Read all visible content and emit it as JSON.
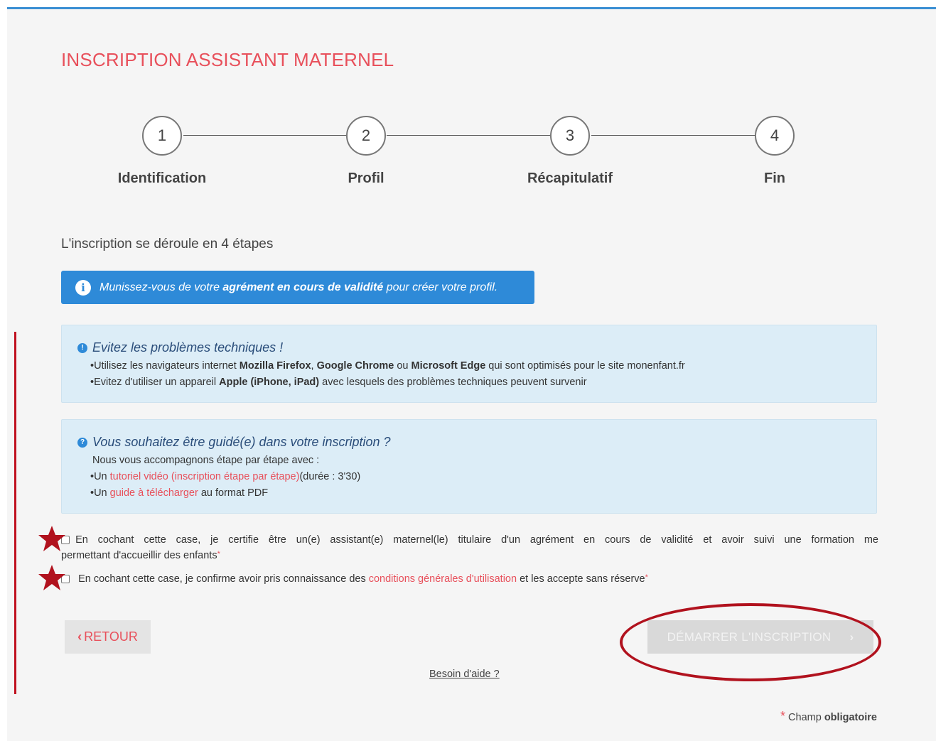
{
  "page": {
    "title": "INSCRIPTION ASSISTANT MATERNEL"
  },
  "stepper": {
    "steps": [
      {
        "number": "1",
        "label": "Identification"
      },
      {
        "number": "2",
        "label": "Profil"
      },
      {
        "number": "3",
        "label": "Récapitulatif"
      },
      {
        "number": "4",
        "label": "Fin"
      }
    ]
  },
  "subtitle": "L'inscription se déroule en 4 étapes",
  "info_bar": {
    "icon": "info-icon",
    "text_before": "Munissez-vous de votre ",
    "text_bold": "agrément en cours de validité",
    "text_after": " pour créer votre profil."
  },
  "panel_technical": {
    "title": "Evitez les problèmes techniques !",
    "line1": {
      "prefix": "•Utilisez les navigateurs internet ",
      "b1": "Mozilla Firefox",
      "sep1": ", ",
      "b2": "Google Chrome",
      "sep2": " ou ",
      "b3": "Microsoft Edge",
      "suffix": " qui sont optimisés pour le site monenfant.fr"
    },
    "line2": {
      "prefix": "•Evitez d'utiliser un appareil ",
      "b1": "Apple (iPhone, iPad)",
      "suffix": " avec lesquels des problèmes techniques peuvent survenir"
    }
  },
  "panel_guide": {
    "title": "Vous souhaitez être guidé(e) dans votre inscription ?",
    "intro": "Nous vous accompagnons étape par étape avec :",
    "line1": {
      "prefix": "•Un ",
      "link": "tutoriel vidéo (inscription étape par étape)",
      "suffix": "(durée : 3'30)"
    },
    "line2": {
      "prefix": "•Un ",
      "link": "guide à télécharger",
      "suffix": " au format PDF"
    }
  },
  "checkboxes": {
    "certify": {
      "line1": "En cochant cette case, je certifie être un(e) assistant(e) maternel(le) titulaire d'un agrément en cours de validité et avoir suivi une formation me",
      "line2": "permettant d'accueillir des enfants",
      "required": "*",
      "checked": false
    },
    "cgu": {
      "prefix": "En cochant cette case, je confirme avoir pris connaissance des ",
      "link": "conditions générales d'utilisation",
      "suffix": " et les accepte sans réserve",
      "required": "*",
      "checked": false
    }
  },
  "buttons": {
    "back": "RETOUR",
    "start": "DÉMARRER L'INSCRIPTION"
  },
  "help_link": "Besoin d'aide ?",
  "required_note": {
    "asterisk": "*",
    "text": "Champ ",
    "bold": "obligatoire"
  },
  "colors": {
    "accent_red": "#e8505b",
    "primary_blue": "#2e8ad8",
    "panel_bg": "#dcedf7",
    "annotation_red": "#b1121e"
  }
}
